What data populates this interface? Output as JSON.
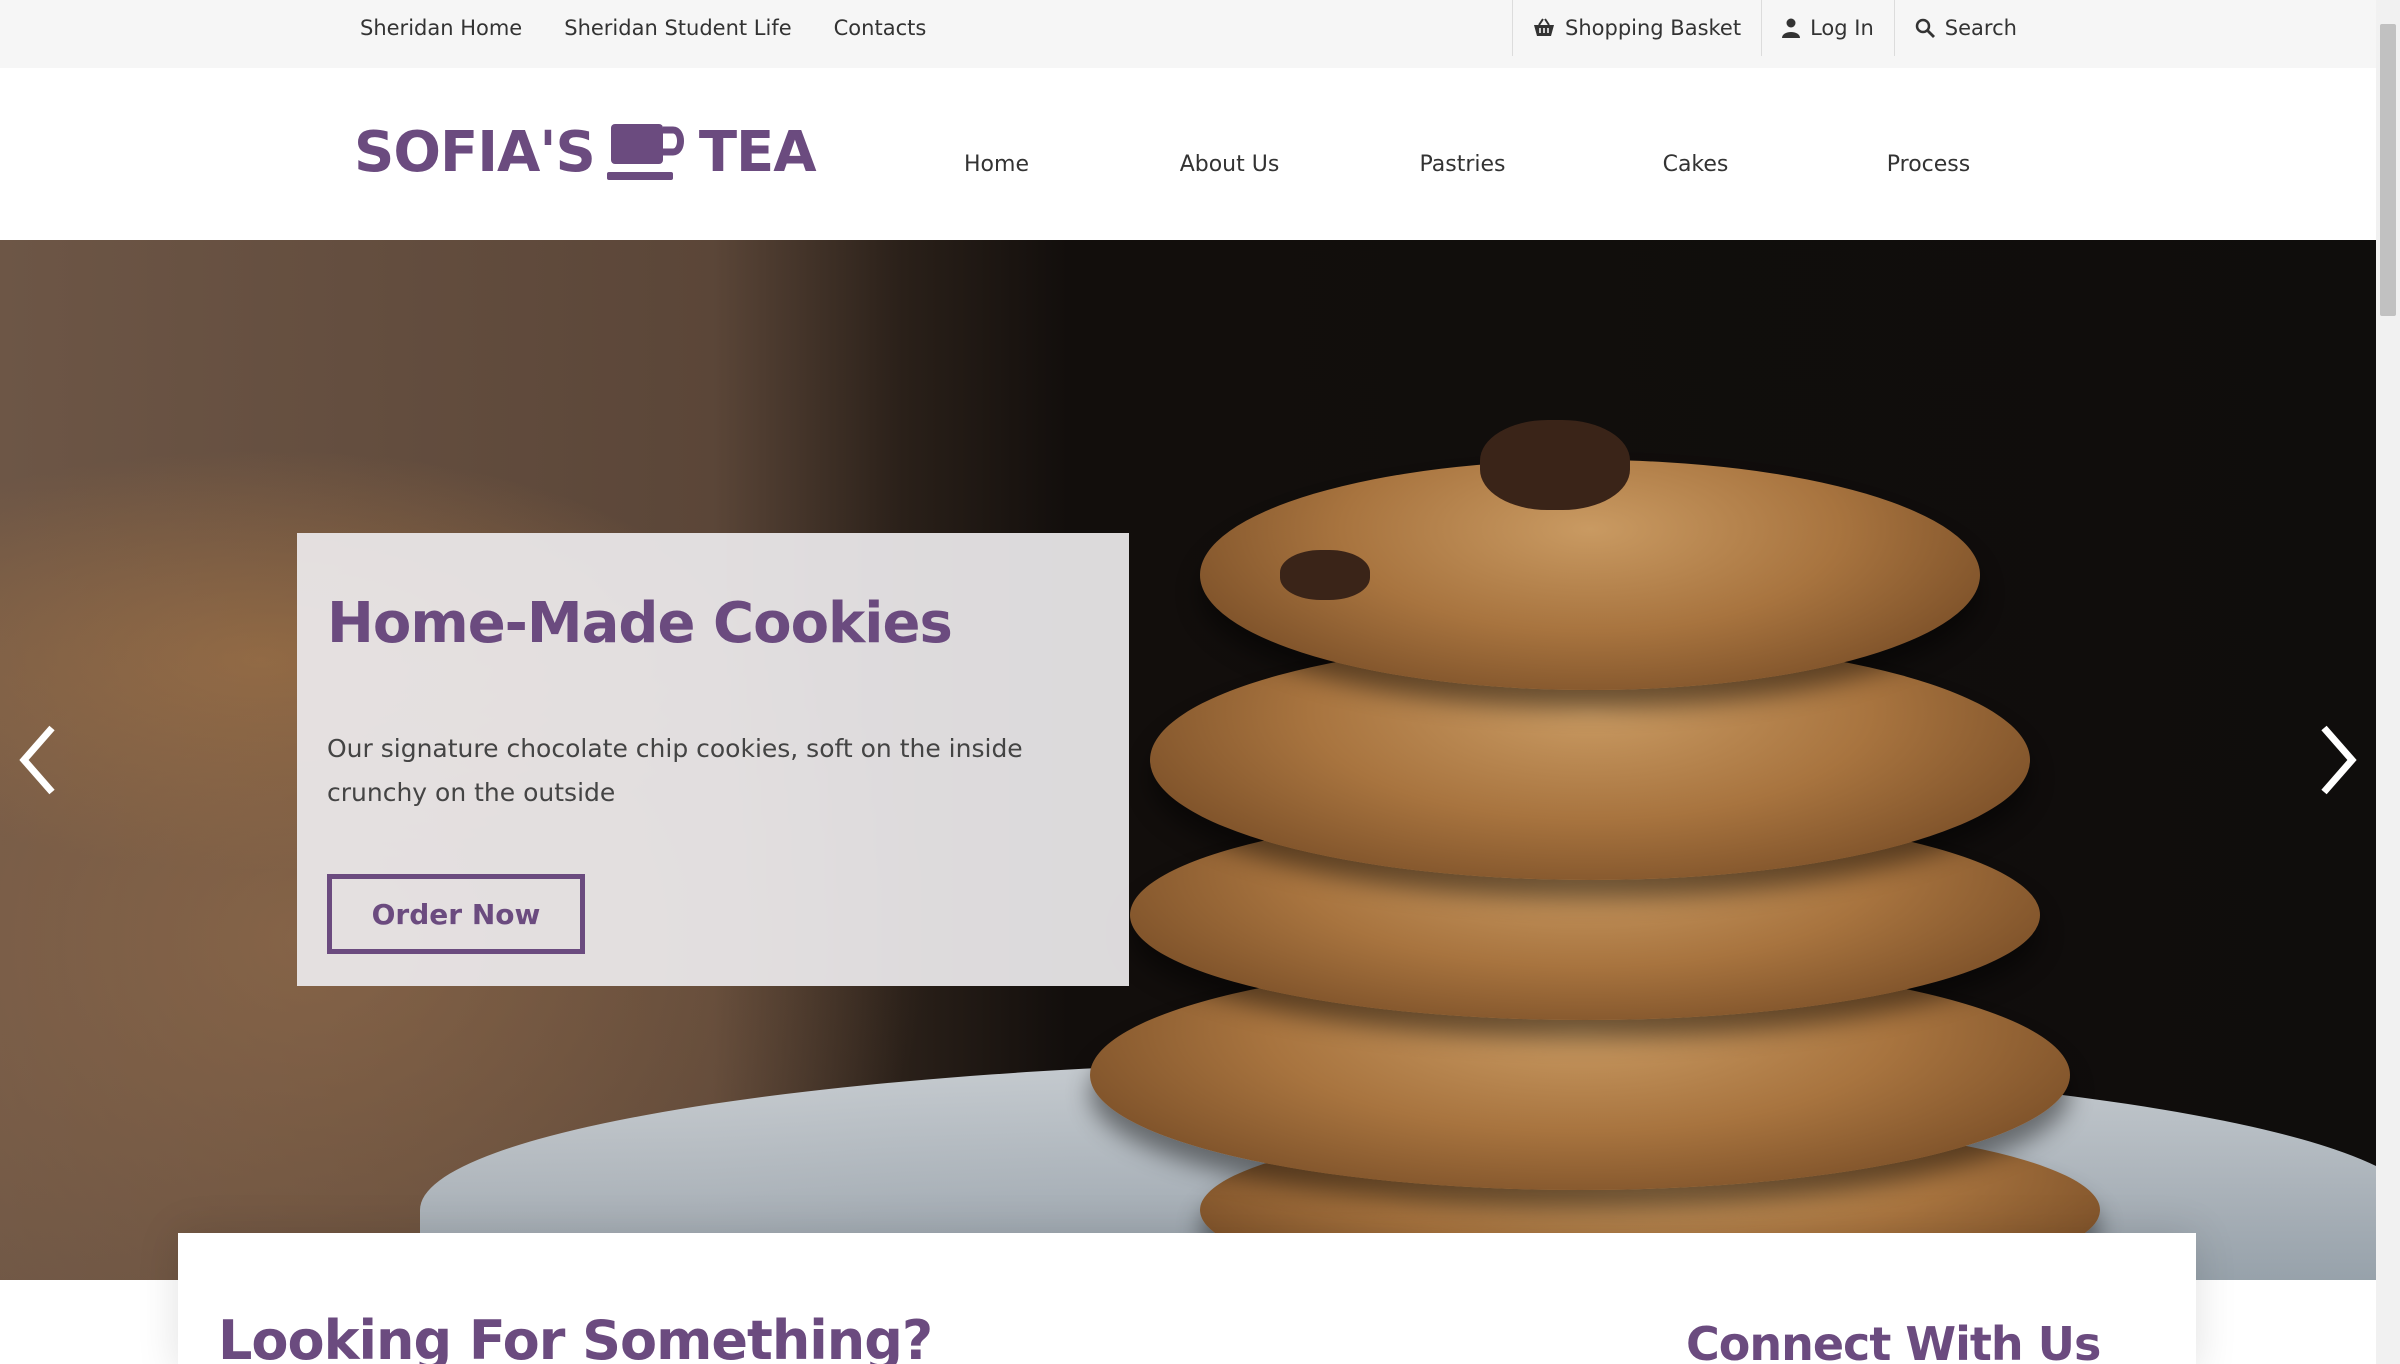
{
  "utility_nav": {
    "left_links": [
      "Sheridan Home",
      "Sheridan Student Life",
      "Contacts"
    ],
    "basket_label": "Shopping Basket",
    "login_label": "Log In",
    "search_label": "Search"
  },
  "header": {
    "logo_left": "SOFIA'S",
    "logo_right": "TEA",
    "nav": [
      "Home",
      "About Us",
      "Pastries",
      "Cakes",
      "Process"
    ]
  },
  "hero": {
    "title": "Home-Made Cookies",
    "text": "Our signature chocolate chip cookies, soft on the inside crunchy on the outside",
    "button_label": "Order Now"
  },
  "bottom": {
    "looking_title": "Looking For Something?",
    "connect_title": "Connect With Us"
  },
  "colors": {
    "brand_purple": "#6b4b7f",
    "utility_bg": "#f6f6f6"
  },
  "icons": [
    "basket-icon",
    "user-icon",
    "search-icon",
    "cup-icon",
    "chevron-left-icon",
    "chevron-right-icon"
  ]
}
